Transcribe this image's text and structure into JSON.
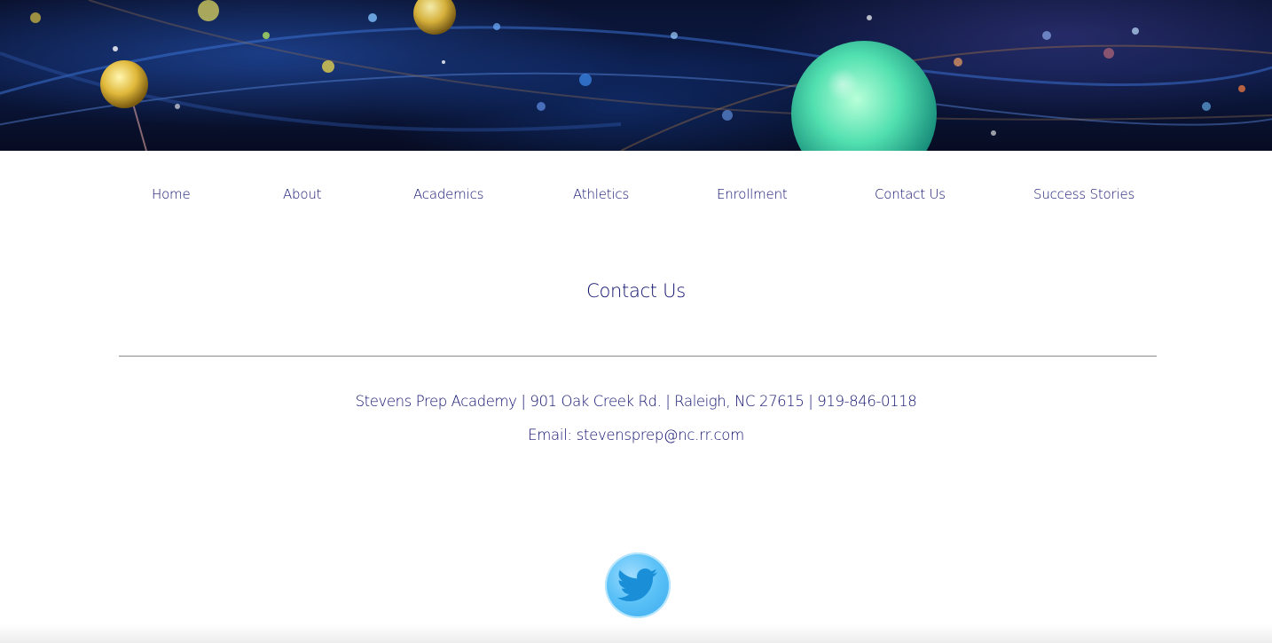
{
  "banner": {
    "alt": ""
  },
  "nav": {
    "items": [
      {
        "label": "Home"
      },
      {
        "label": "About"
      },
      {
        "label": "Academics"
      },
      {
        "label": "Athletics"
      },
      {
        "label": "Enrollment"
      },
      {
        "label": "Contact Us"
      },
      {
        "label": "Success Stories"
      }
    ]
  },
  "main": {
    "title": "Contact Us",
    "address": "Stevens Prep Academy | 901 Oak Creek Rd. | Raleigh, NC 27615 | 919-846-0118",
    "email_label": "Email: ",
    "email": "stevensprep@nc.rr.com"
  },
  "social": {
    "twitter_icon": "twitter-bird-icon"
  },
  "colors": {
    "text": "#10106e",
    "twitter": "#3aa9ee",
    "divider": "#8a8a8a"
  }
}
